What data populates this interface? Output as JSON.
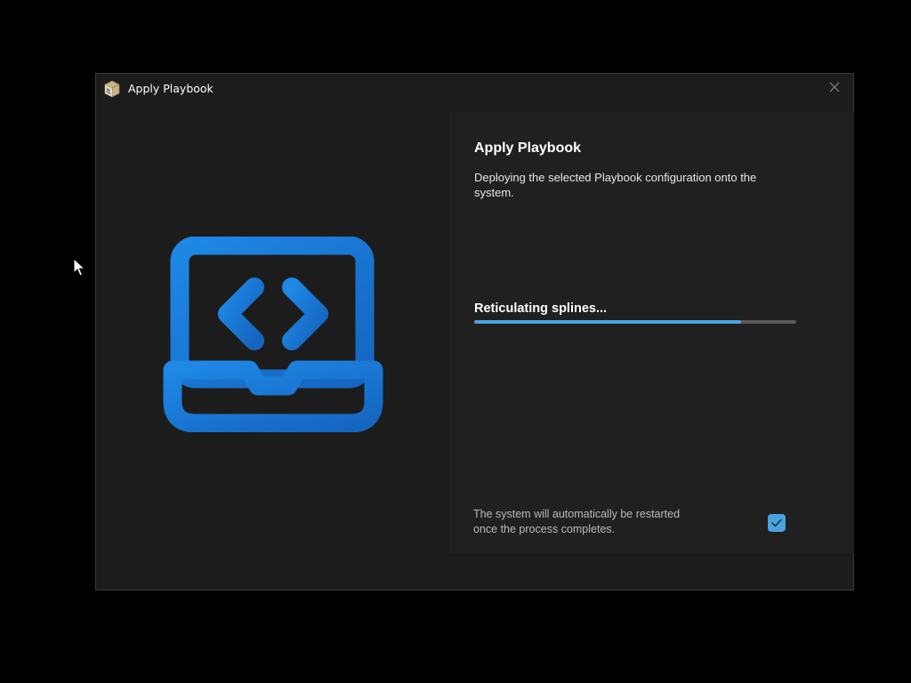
{
  "window": {
    "title": "Apply Playbook",
    "app_icon": "playbook-box-icon",
    "close_icon": "close-icon"
  },
  "hero": {
    "icon": "laptop-code-icon"
  },
  "main": {
    "heading": "Apply Playbook",
    "description": "Deploying the selected Playbook configuration onto the system.",
    "status": "Reticulating splines...",
    "progress": 0.83,
    "restart_note": "The system will automatically be restarted once the process completes.",
    "restart_checked": true
  },
  "colors": {
    "accent": "#4aa3df",
    "hero_blue": "#1a7fd4",
    "window_bg": "#1c1c1c",
    "pane_bg": "#202020"
  }
}
